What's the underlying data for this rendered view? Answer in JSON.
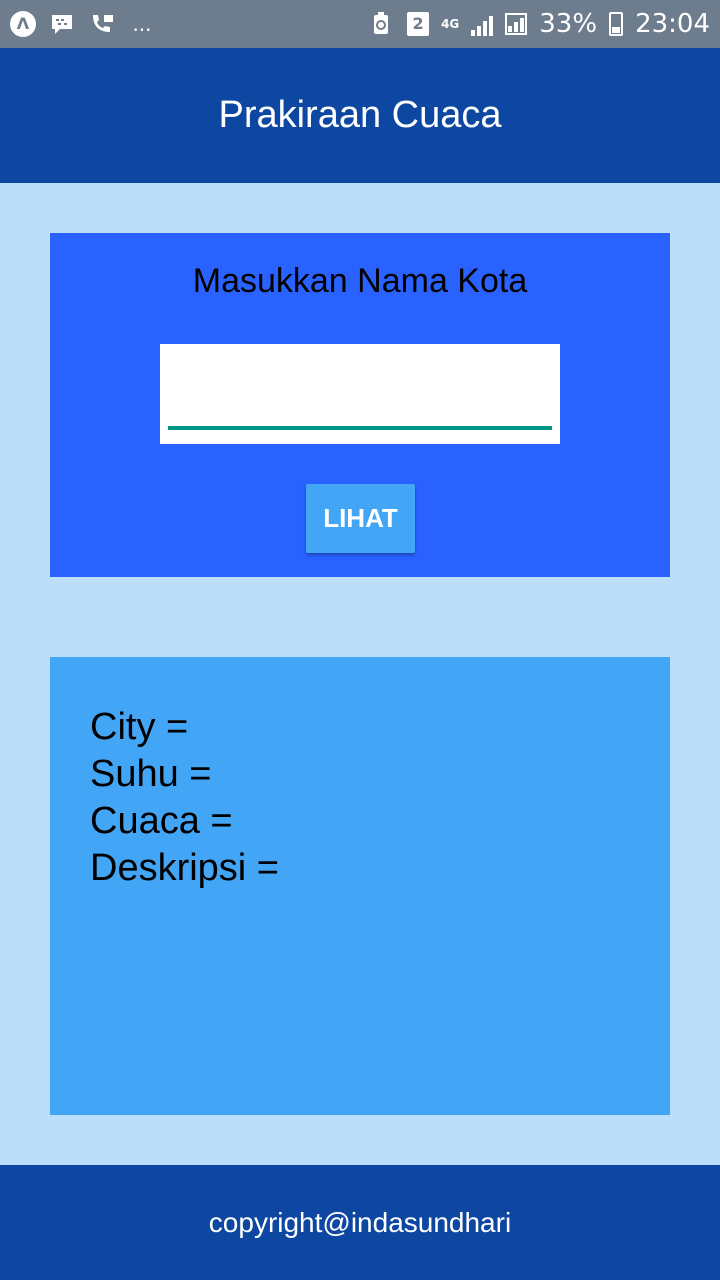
{
  "status_bar": {
    "battery": "33%",
    "time": "23:04",
    "sim_slot": "2",
    "network": "4G",
    "more_indicator": "...",
    "icons": [
      "app-notification-icon",
      "bbm-icon",
      "call-forward-icon",
      "recycle-icon",
      "sim-icon",
      "signal-icon",
      "battery-icon"
    ]
  },
  "header": {
    "title": "Prakiraan Cuaca"
  },
  "search": {
    "title": "Masukkan Nama Kota",
    "value": "",
    "button_label": "LIHAT"
  },
  "result": {
    "city_label": "City =",
    "temp_label": "Suhu =",
    "weather_label": "Cuaca =",
    "description_label": "Deskripsi ="
  },
  "footer": {
    "copyright": "copyright@indasundhari"
  },
  "colors": {
    "status_bar": "#6d7d8d",
    "header": "#0d47a1",
    "background": "#bbdefb",
    "input_card": "#2962ff",
    "button": "#42a5f5",
    "result_card": "#42a5f5",
    "underline": "#009688"
  }
}
